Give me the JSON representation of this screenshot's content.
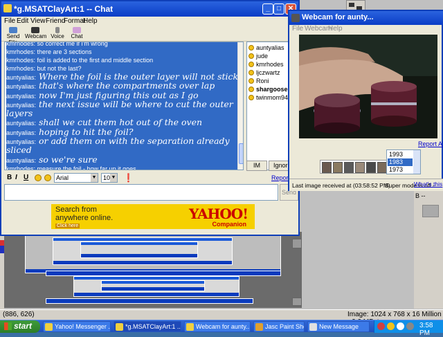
{
  "chat": {
    "title": "*g.MSATClayArt:1 -- Chat",
    "menu": [
      "File",
      "Edit",
      "View",
      "Friend",
      "Format",
      "Help"
    ],
    "toolbar": [
      {
        "label": "Send File",
        "icon": "send-file-icon"
      },
      {
        "label": "Webcam",
        "icon": "webcam-icon"
      },
      {
        "label": "Voice",
        "icon": "voice-icon"
      },
      {
        "label": "Chat",
        "icon": "chat-icon"
      }
    ],
    "messages": [
      {
        "from": "kmrhodes",
        "text": "kmrhodes: so correct me if i'm wrong",
        "style": "kmr"
      },
      {
        "from": "kmrhodes",
        "text": "kmrhodes: there are 3 sections",
        "style": "kmr"
      },
      {
        "from": "kmrhodes",
        "text": "kmrhodes: foil is added to the first and middle section",
        "style": "kmr"
      },
      {
        "from": "kmrhodes",
        "text": "kmrhodes: but not the last?",
        "style": "kmr"
      },
      {
        "from": "auntyalias",
        "name": "auntyalias:",
        "text": "Where the foil is the outer layer will not stick",
        "style": "aunty"
      },
      {
        "from": "auntyalias",
        "name": "auntyalias:",
        "text": "that's where the compartments over lap",
        "style": "aunty"
      },
      {
        "from": "auntyalias",
        "name": "auntyalias:",
        "text": "now I'm just figuring this out as I go",
        "style": "aunty"
      },
      {
        "from": "auntyalias",
        "name": "auntyalias:",
        "text": "the next issue will be where to cut the outer",
        "style": "aunty"
      },
      {
        "from": "auntyalias",
        "name": "",
        "text": "layers",
        "style": "aunty"
      },
      {
        "from": "auntyalias",
        "name": "auntyalias:",
        "text": "shall we cut them hot out of the oven",
        "style": "aunty"
      },
      {
        "from": "auntyalias",
        "name": "auntyalias:",
        "text": "hoping to hit the foil?",
        "style": "aunty"
      },
      {
        "from": "auntyalias",
        "name": "auntyalias:",
        "text": "or add them on with the separation already",
        "style": "aunty"
      },
      {
        "from": "auntyalias",
        "name": "",
        "text": "sliced",
        "style": "aunty"
      },
      {
        "from": "auntyalias",
        "name": "auntyalias:",
        "text": "so we're sure",
        "style": "aunty"
      },
      {
        "from": "kmrhodes",
        "text": "kmrhodes: measure the foil - how far up it goes",
        "style": "kmr"
      }
    ],
    "users": [
      {
        "name": "auntyalias",
        "bold": false
      },
      {
        "name": "jude",
        "bold": false
      },
      {
        "name": "kmrhodes",
        "bold": false
      },
      {
        "name": "ljczwartz",
        "bold": false
      },
      {
        "name": "Roni",
        "bold": false
      },
      {
        "name": "shargoose",
        "bold": true
      },
      {
        "name": "twinmom94002",
        "bold": false
      }
    ],
    "im_label": "IM",
    "ignore_label": "Ignore U",
    "font": "Arial",
    "font_size": "10",
    "report_abuse": "Report A",
    "send_label": "Send",
    "input_value": ""
  },
  "ad": {
    "line1": "Search from",
    "line2": "anywhere online.",
    "cta": "Click here",
    "brand": "YAHOO!",
    "product": "Companion"
  },
  "webcam": {
    "title": "Webcam for aunty...",
    "menu": [
      "File",
      "Webcam",
      "Help"
    ],
    "report_abuse": "Report Abu",
    "years": [
      "1993",
      "1983",
      "1973"
    ],
    "selected_year": "1983",
    "last_image": "Last image received at (03:58:52 PM)",
    "super_mode": "Super mode is off -",
    "whats_this": "What's this"
  },
  "paintshop": {
    "coords": "(886, 626)",
    "image_info": "Image:  1024 x 768 x 16 Million - 2.2 MBytes",
    "right_panel_label": "B  --"
  },
  "taskbar": {
    "start": "start",
    "tasks": [
      {
        "label": "Yahoo! Messenger ...",
        "icon_color": "#f0d040",
        "active": false
      },
      {
        "label": "*g.MSATClayArt:1 ...",
        "icon_color": "#f0d040",
        "active": true
      },
      {
        "label": "Webcam for aunty...",
        "icon_color": "#f0d040",
        "active": false
      },
      {
        "label": "Jasc Paint Shop Pro...",
        "icon_color": "#e0a030",
        "active": false
      },
      {
        "label": "New Message",
        "icon_color": "#e0e0e0",
        "active": false
      }
    ],
    "clock": "3:58 PM"
  }
}
